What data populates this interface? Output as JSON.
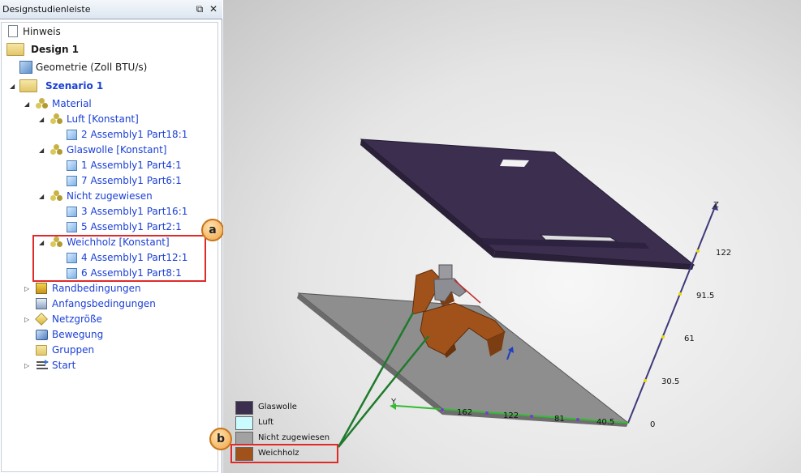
{
  "panel": {
    "title": "Designstudienleiste",
    "restore_glyph": "⧉",
    "close_glyph": "✕"
  },
  "tree": {
    "hinweis": "Hinweis",
    "design": "Design 1",
    "geometrie": "Geometrie (Zoll BTU/s)",
    "szenario": "Szenario 1",
    "material": "Material",
    "luft": "Luft [Konstant]",
    "luft_part": "2 Assembly1  Part18:1",
    "glaswolle": "Glaswolle [Konstant]",
    "glaswolle_p1": "1 Assembly1  Part4:1",
    "glaswolle_p2": "7 Assembly1  Part6:1",
    "nicht": "Nicht zugewiesen",
    "nicht_p1": "3 Assembly1  Part16:1",
    "nicht_p2": "5 Assembly1  Part2:1",
    "weichholz": "Weichholz [Konstant]",
    "weichholz_p1": "4 Assembly1  Part12:1",
    "weichholz_p2": "6 Assembly1  Part8:1",
    "randbedingungen": "Randbedingungen",
    "anfangsbedingungen": "Anfangsbedingungen",
    "netzgroesse": "Netzgröße",
    "bewegung": "Bewegung",
    "gruppen": "Gruppen",
    "start": "Start"
  },
  "callouts": {
    "a": "a",
    "b": "b"
  },
  "axis": {
    "z_label": "Z",
    "y_label": "Y",
    "z_ticks": [
      "122",
      "91.5",
      "61",
      "30.5",
      "0"
    ],
    "y_ticks": [
      "162",
      "122",
      "81",
      "40.5"
    ]
  },
  "legend": {
    "items": [
      {
        "label": "Glaswolle",
        "color": "#3b2e4f"
      },
      {
        "label": "Luft",
        "color": "#c9fbff"
      },
      {
        "label": "Nicht zugewiesen",
        "color": "#a2a2a2"
      },
      {
        "label": "Weichholz",
        "color": "#a0521a"
      }
    ]
  },
  "colors": {
    "plate_top": "#3b2e4f",
    "plate_bottom": "#8e8e8e",
    "wood": "#a0521a",
    "axis_line": "#3d3a7a",
    "leader": "#1f7a2c",
    "highlight": "#e02a2a"
  }
}
